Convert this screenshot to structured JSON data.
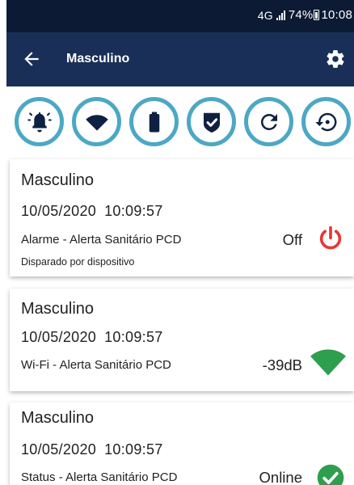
{
  "status_bar": {
    "network": "4G",
    "battery": "74%",
    "time": "10:08"
  },
  "app_bar": {
    "title": "Masculino",
    "back_icon": "arrow-left-icon",
    "settings_icon": "gear-icon"
  },
  "action_icons": [
    "bell-icon",
    "wifi-icon",
    "battery-icon",
    "shield-check-icon",
    "refresh-icon",
    "history-icon"
  ],
  "colors": {
    "status_bar_bg": "#0c1b33",
    "app_bar_bg": "#1a2f57",
    "icon_ring": "#4ca8c4",
    "icon_fill": "#0f2142",
    "power_red": "#e53935",
    "signal_green": "#2e9e4f"
  },
  "cards": [
    {
      "name": "Masculino",
      "date": "10/05/2020",
      "time": "10:09:57",
      "device": "Alarme - Alerta Sanitário PCD",
      "subtitle": "Disparado por dispositivo",
      "value": "Off",
      "icon": "power-icon"
    },
    {
      "name": "Masculino",
      "date": "10/05/2020",
      "time": "10:09:57",
      "device": "Wi-Fi - Alerta Sanitário PCD",
      "value": "-39dB",
      "icon": "wifi-signal-icon"
    },
    {
      "name": "Masculino",
      "date": "10/05/2020",
      "time": "10:09:57",
      "device": "Status - Alerta Sanitário PCD",
      "value": "Online",
      "icon": "check-circle-icon"
    }
  ]
}
